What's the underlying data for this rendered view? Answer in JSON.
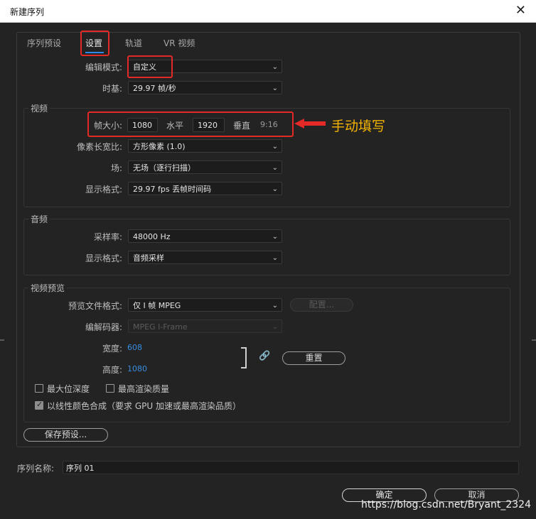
{
  "window": {
    "title": "新建序列",
    "close_glyph": "✕"
  },
  "tabs": [
    "序列预设",
    "设置",
    "轨道",
    "VR 视频"
  ],
  "active_tab_index": 1,
  "settings": {
    "edit_mode_label": "编辑模式:",
    "edit_mode_value": "自定义",
    "timebase_label": "时基:",
    "timebase_value": "29.97 帧/秒"
  },
  "video": {
    "title": "视频",
    "frame_size_label": "帧大小:",
    "frame_width": "1080",
    "horizontal_label": "水平",
    "frame_height": "1920",
    "vertical_label": "垂直",
    "aspect": "9:16",
    "pixel_aspect_label": "像素长宽比:",
    "pixel_aspect_value": "方形像素 (1.0)",
    "fields_label": "场:",
    "fields_value": "无场（逐行扫描）",
    "display_format_label": "显示格式:",
    "display_format_value": "29.97 fps 丢帧时间码"
  },
  "annotation": {
    "text": "手动填写",
    "color": "#f5b400",
    "box_color": "#e32a26"
  },
  "audio": {
    "title": "音频",
    "sample_rate_label": "采样率:",
    "sample_rate_value": "48000 Hz",
    "display_format_label": "显示格式:",
    "display_format_value": "音频采样"
  },
  "preview": {
    "title": "视频预览",
    "file_format_label": "预览文件格式:",
    "file_format_value": "仅 I 帧 MPEG",
    "config_button": "配置...",
    "codec_label": "编解码器:",
    "codec_value": "MPEG I-Frame",
    "width_label": "宽度:",
    "width_value": "608",
    "height_label": "高度:",
    "height_value": "1080",
    "reset_button": "重置",
    "max_bit_depth": "最大位深度",
    "max_render_quality": "最高渲染质量",
    "linear_color": "以线性颜色合成（要求 GPU 加速或最高渲染品质）",
    "linear_color_checked": true
  },
  "save_preset_button": "保存预设...",
  "sequence_name_label": "序列名称:",
  "sequence_name_value": "序列 01",
  "ok_button": "确定",
  "cancel_button": "取消",
  "watermark": "https://blog.csdn.net/Bryant_2324",
  "icons": {
    "chevron": "⌄",
    "chain": "🔗"
  }
}
